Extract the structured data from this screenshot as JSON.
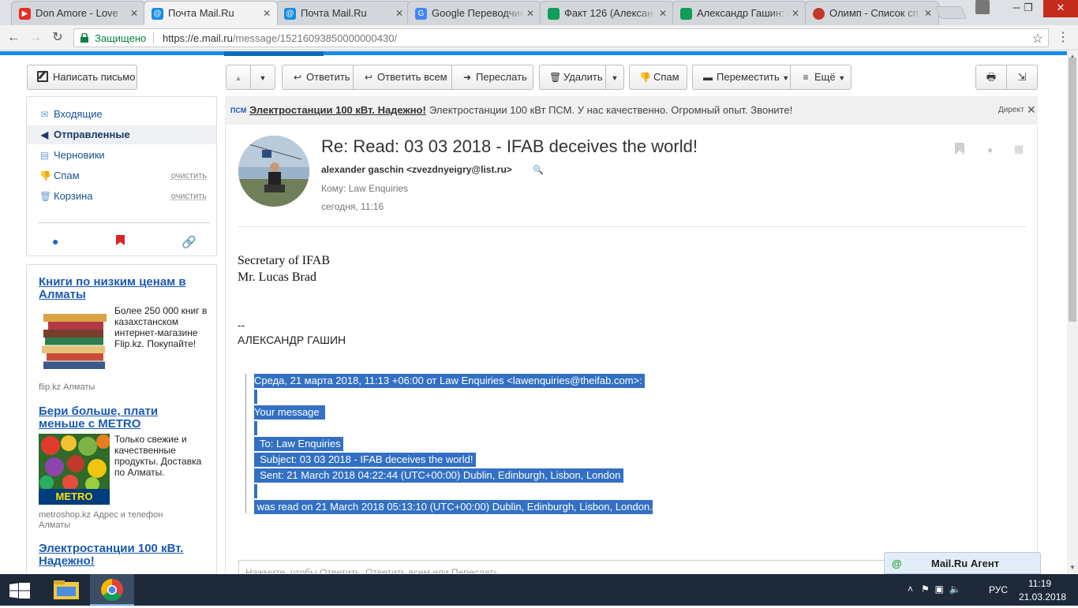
{
  "browser": {
    "tabs": [
      {
        "title": "Don Amore - Love",
        "favicon": "youtube-icon",
        "color": "#e52d27"
      },
      {
        "title": "Почта Mail.Ru",
        "favicon": "mailru-icon",
        "color": "#168de2",
        "active": true
      },
      {
        "title": "Почта Mail.Ru",
        "favicon": "mailru-icon",
        "color": "#168de2"
      },
      {
        "title": "Google Переводчик",
        "favicon": "google-translate-icon",
        "color": "#4285f4"
      },
      {
        "title": "Факт 126 (Алексан",
        "favicon": "sheets-icon",
        "color": "#0f9d58"
      },
      {
        "title": "Александр Гашин: (",
        "favicon": "sheets-icon",
        "color": "#0f9d58"
      },
      {
        "title": "Олимп - Список сп",
        "favicon": "olymp-icon",
        "color": "#c0392b"
      }
    ],
    "secure_label": "Защищено",
    "url_host": "https://e.mail.ru",
    "url_path": "/message/15216093850000000430/"
  },
  "sidebar": {
    "compose_label": "Написать письмо",
    "folders": [
      {
        "label": "Входящие",
        "icon": "inbox-icon"
      },
      {
        "label": "Отправленные",
        "icon": "sent-icon",
        "active": true
      },
      {
        "label": "Черновики",
        "icon": "drafts-icon"
      },
      {
        "label": "Спам",
        "icon": "spam-icon",
        "action": "очистить"
      },
      {
        "label": "Корзина",
        "icon": "trash-icon",
        "action": "очистить"
      }
    ]
  },
  "ads": [
    {
      "title": "Книги по низким ценам в Алматы",
      "text": "Более 250 000 книг в казахстанском интернет-магазине Flip.kz. Покупайте!",
      "source": "flip.kz   Алматы"
    },
    {
      "title": "Бери больше, плати меньше с METRO",
      "text": "Только свежие и качественные продукты. Доставка по Алматы.",
      "source": "metroshop.kz   Адрес и телефон",
      "source2": "Алматы",
      "badge": "METRO"
    },
    {
      "title": "Электростанции 100 кВт. Надежно!"
    }
  ],
  "toolbar": {
    "reply": "Ответить",
    "reply_all": "Ответить всем",
    "forward": "Переслать",
    "delete": "Удалить",
    "spam": "Спам",
    "move": "Переместить",
    "more": "Ещё"
  },
  "direct": {
    "logo": "ПСМ",
    "title": "Электростанции 100 кВт. Надежно!",
    "text": "Электростанции 100 кВт ПСМ. У нас качественно. Огромный опыт. Звоните!",
    "label": "Директ"
  },
  "message": {
    "subject": "Re: Read: 03 03 2018 - IFAB deceives the world!",
    "sender": "alexander gaschin <zvezdnyeigry@list.ru>",
    "to": "Кому: Law Enquiries",
    "date": "сегодня, 11:16",
    "body_line1": "Secretary of IFAB",
    "body_line2": "Mr. Lucas Brad",
    "sig_dash": "--",
    "sig_name": "АЛЕКСАНДР ГАШИН",
    "quote": [
      "Среда, 21 марта 2018, 11:13 +06:00 от Law Enquiries <lawenquiries@theifab.com>: ",
      " ",
      "Your message  ",
      " ",
      "  To: Law Enquiries ",
      "  Subject: 03 03 2018 - IFAB deceives the world! ",
      "  Sent: 21 March 2018 04:22:44 (UTC+00:00) Dublin, Edinburgh, Lisbon, London ",
      " ",
      " was read on 21 March 2018 05:13:10 (UTC+00:00) Dublin, Edinburgh, Lisbon, London."
    ],
    "reply_placeholder": "Нажмите, чтобы Ответить, Ответить всем или Переслать"
  },
  "agent": {
    "label": "Mail.Ru Агент"
  },
  "taskbar": {
    "lang": "РУС",
    "time": "11:19",
    "date": "21.03.2018"
  }
}
